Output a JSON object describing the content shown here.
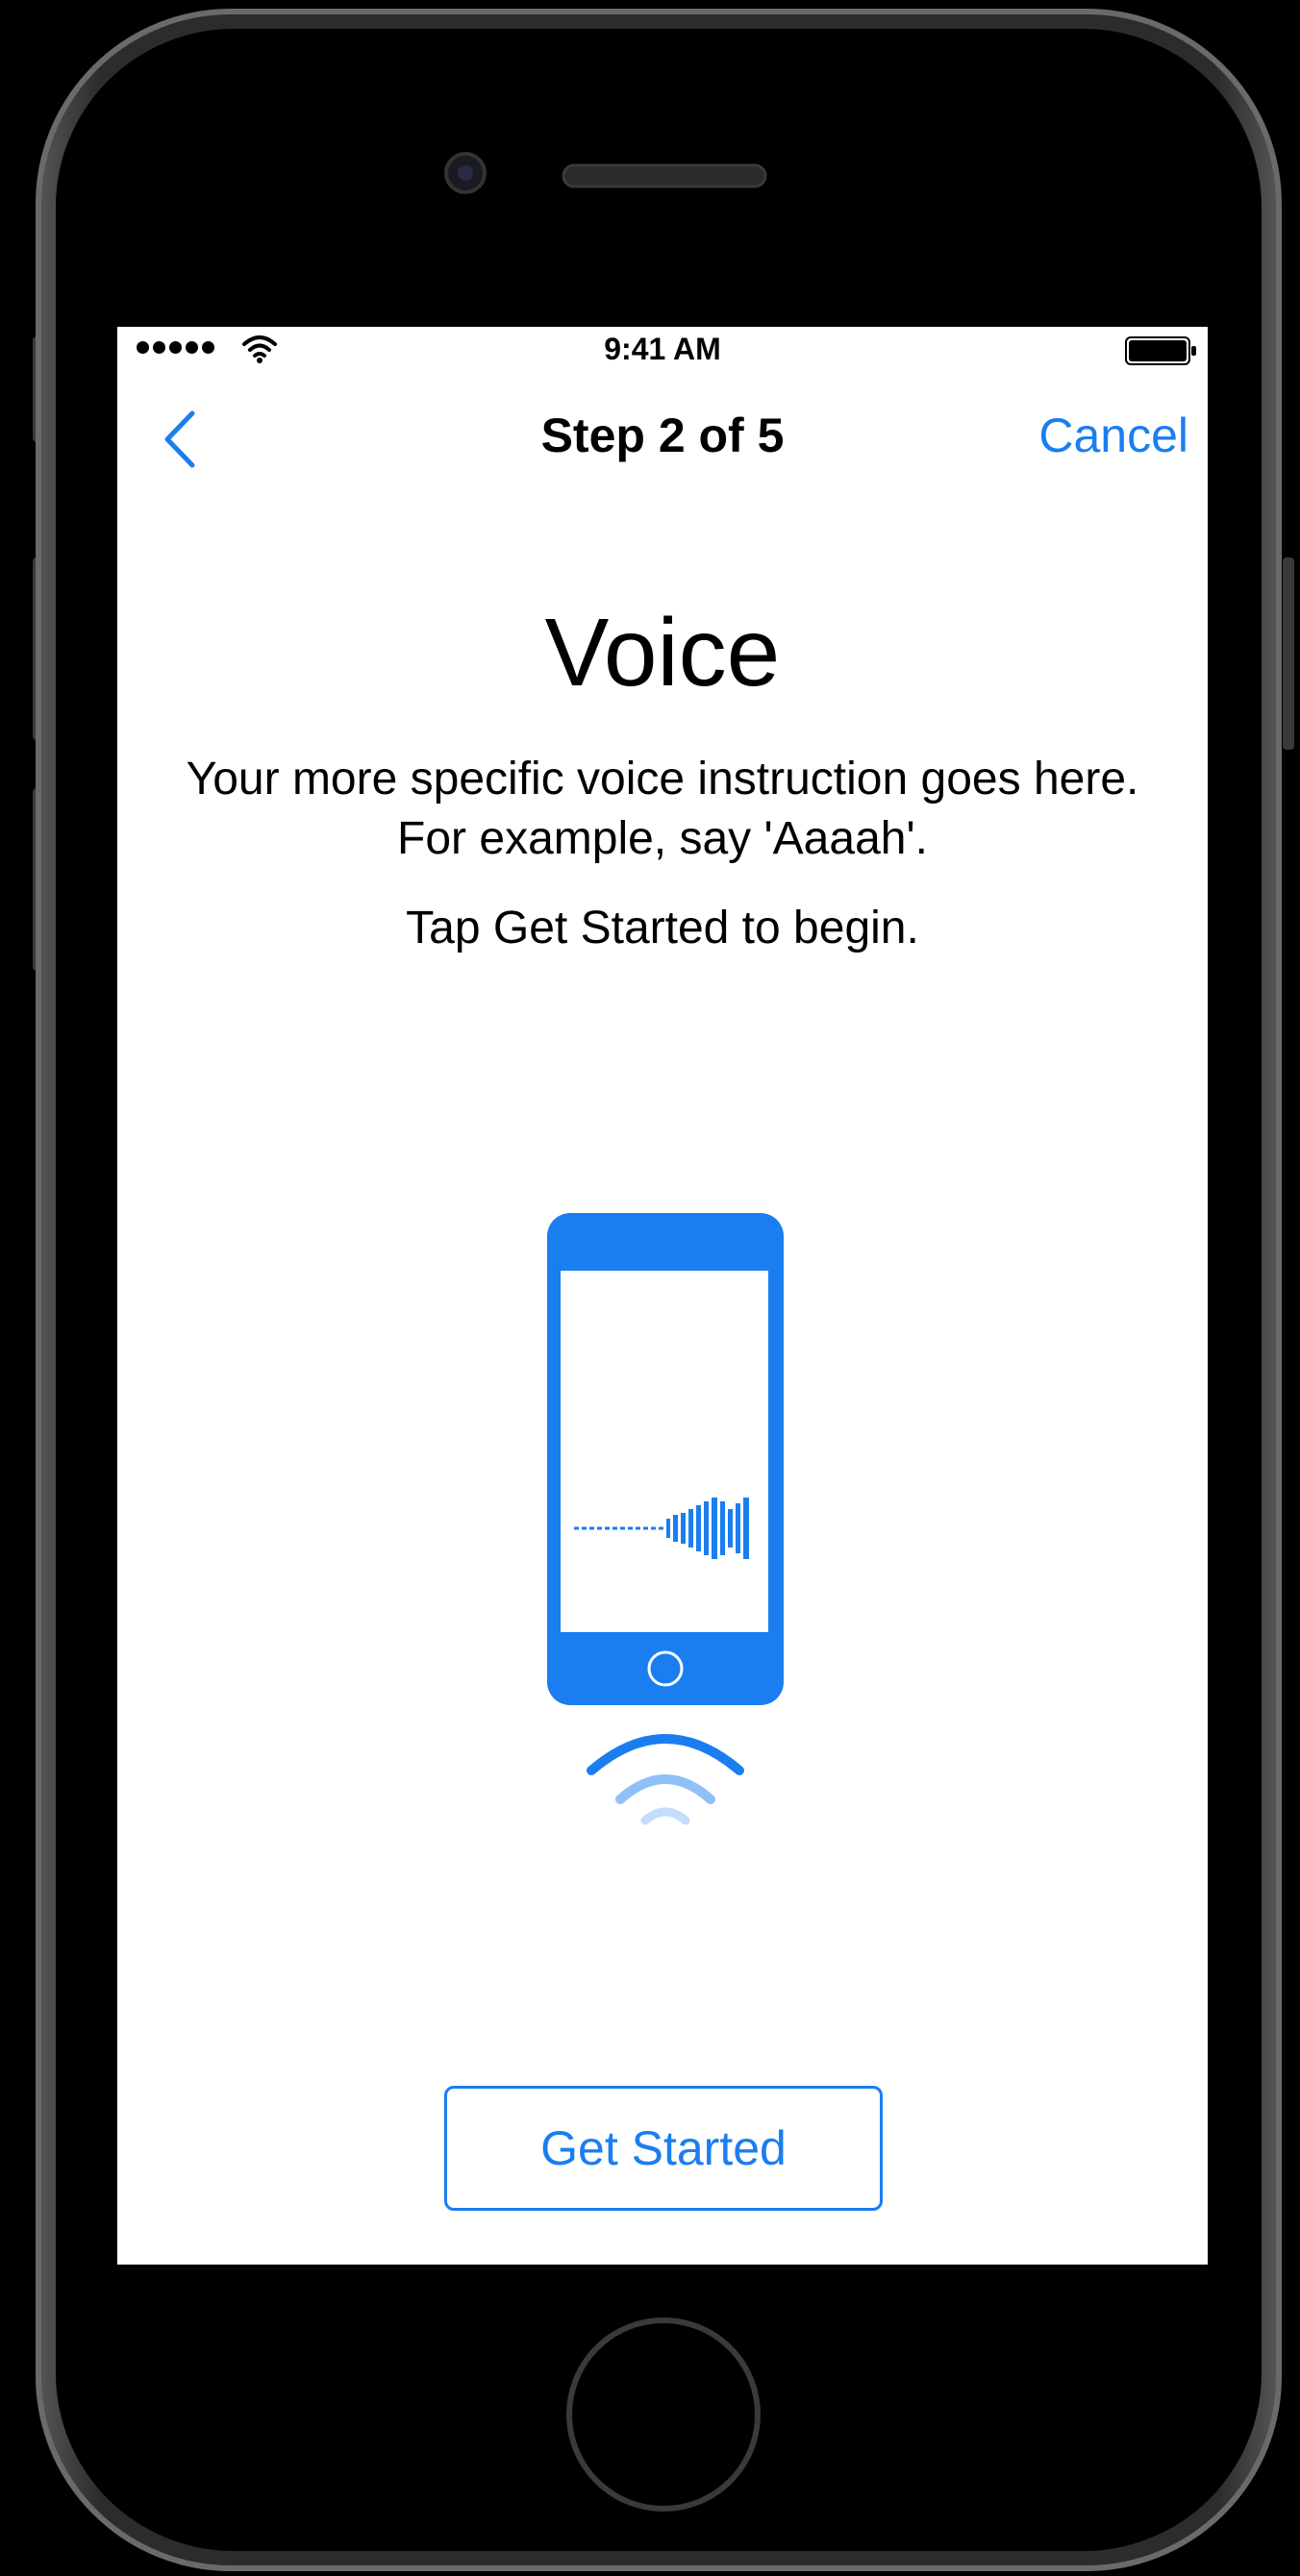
{
  "status_bar": {
    "time": "9:41 AM",
    "signal_icon": "cellular-signal-dots",
    "wifi_icon": "wifi-icon",
    "battery_icon": "battery-full-icon"
  },
  "nav": {
    "back_icon": "chevron-left-icon",
    "title": "Step 2 of 5",
    "cancel_label": "Cancel"
  },
  "content": {
    "heading": "Voice",
    "instruction": "Your more specific voice instruction goes here. For example, say 'Aaaah'.",
    "hint": "Tap Get Started to begin.",
    "illustration_icon": "phone-voice-waveform-icon"
  },
  "actions": {
    "get_started_label": "Get Started"
  },
  "colors": {
    "accent": "#1a7ef0",
    "accent_light": "#8fc0f7",
    "device_frame": "#2b2b2d",
    "screen_bg": "#ffffff"
  }
}
